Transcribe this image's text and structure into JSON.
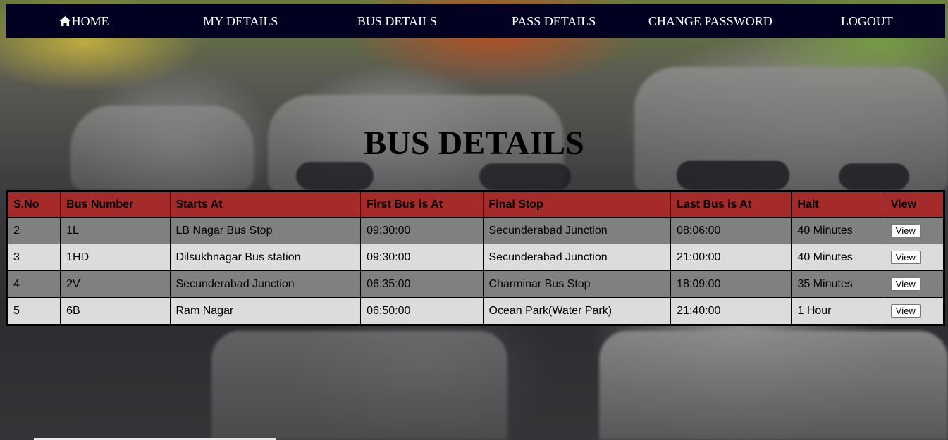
{
  "nav": {
    "items": [
      {
        "label": "HOME",
        "icon": "home-icon"
      },
      {
        "label": "MY DETAILS"
      },
      {
        "label": "BUS DETAILS"
      },
      {
        "label": "PASS DETAILS"
      },
      {
        "label": "CHANGE PASSWORD"
      },
      {
        "label": "LOGOUT"
      }
    ],
    "background": "#020121"
  },
  "page_title": "BUS DETAILS",
  "table": {
    "header_color": "#a52a2a",
    "columns": [
      "S.No",
      "Bus Number",
      "Starts At",
      "First Bus is At",
      "Final Stop",
      "Last Bus is At",
      "Halt",
      "View"
    ],
    "rows": [
      {
        "sno": "2",
        "bus_number": "1L",
        "starts_at": "LB Nagar Bus Stop",
        "first_bus": "09:30:00",
        "final_stop": "Secunderabad Junction",
        "last_bus": "08:06:00",
        "halt": "40 Minutes",
        "view": "View"
      },
      {
        "sno": "3",
        "bus_number": "1HD",
        "starts_at": "Dilsukhnagar Bus station",
        "first_bus": "09:30:00",
        "final_stop": "Secunderabad Junction",
        "last_bus": "21:00:00",
        "halt": "40 Minutes",
        "view": "View"
      },
      {
        "sno": "4",
        "bus_number": "2V",
        "starts_at": "Secunderabad Junction",
        "first_bus": "06:35:00",
        "final_stop": "Charminar Bus Stop",
        "last_bus": "18:09:00",
        "halt": "35 Minutes",
        "view": "View"
      },
      {
        "sno": "5",
        "bus_number": "6B",
        "starts_at": "Ram Nagar",
        "first_bus": "06:50:00",
        "final_stop": "Ocean Park(Water Park)",
        "last_bus": "21:40:00",
        "halt": "1 Hour",
        "view": "View"
      }
    ]
  }
}
